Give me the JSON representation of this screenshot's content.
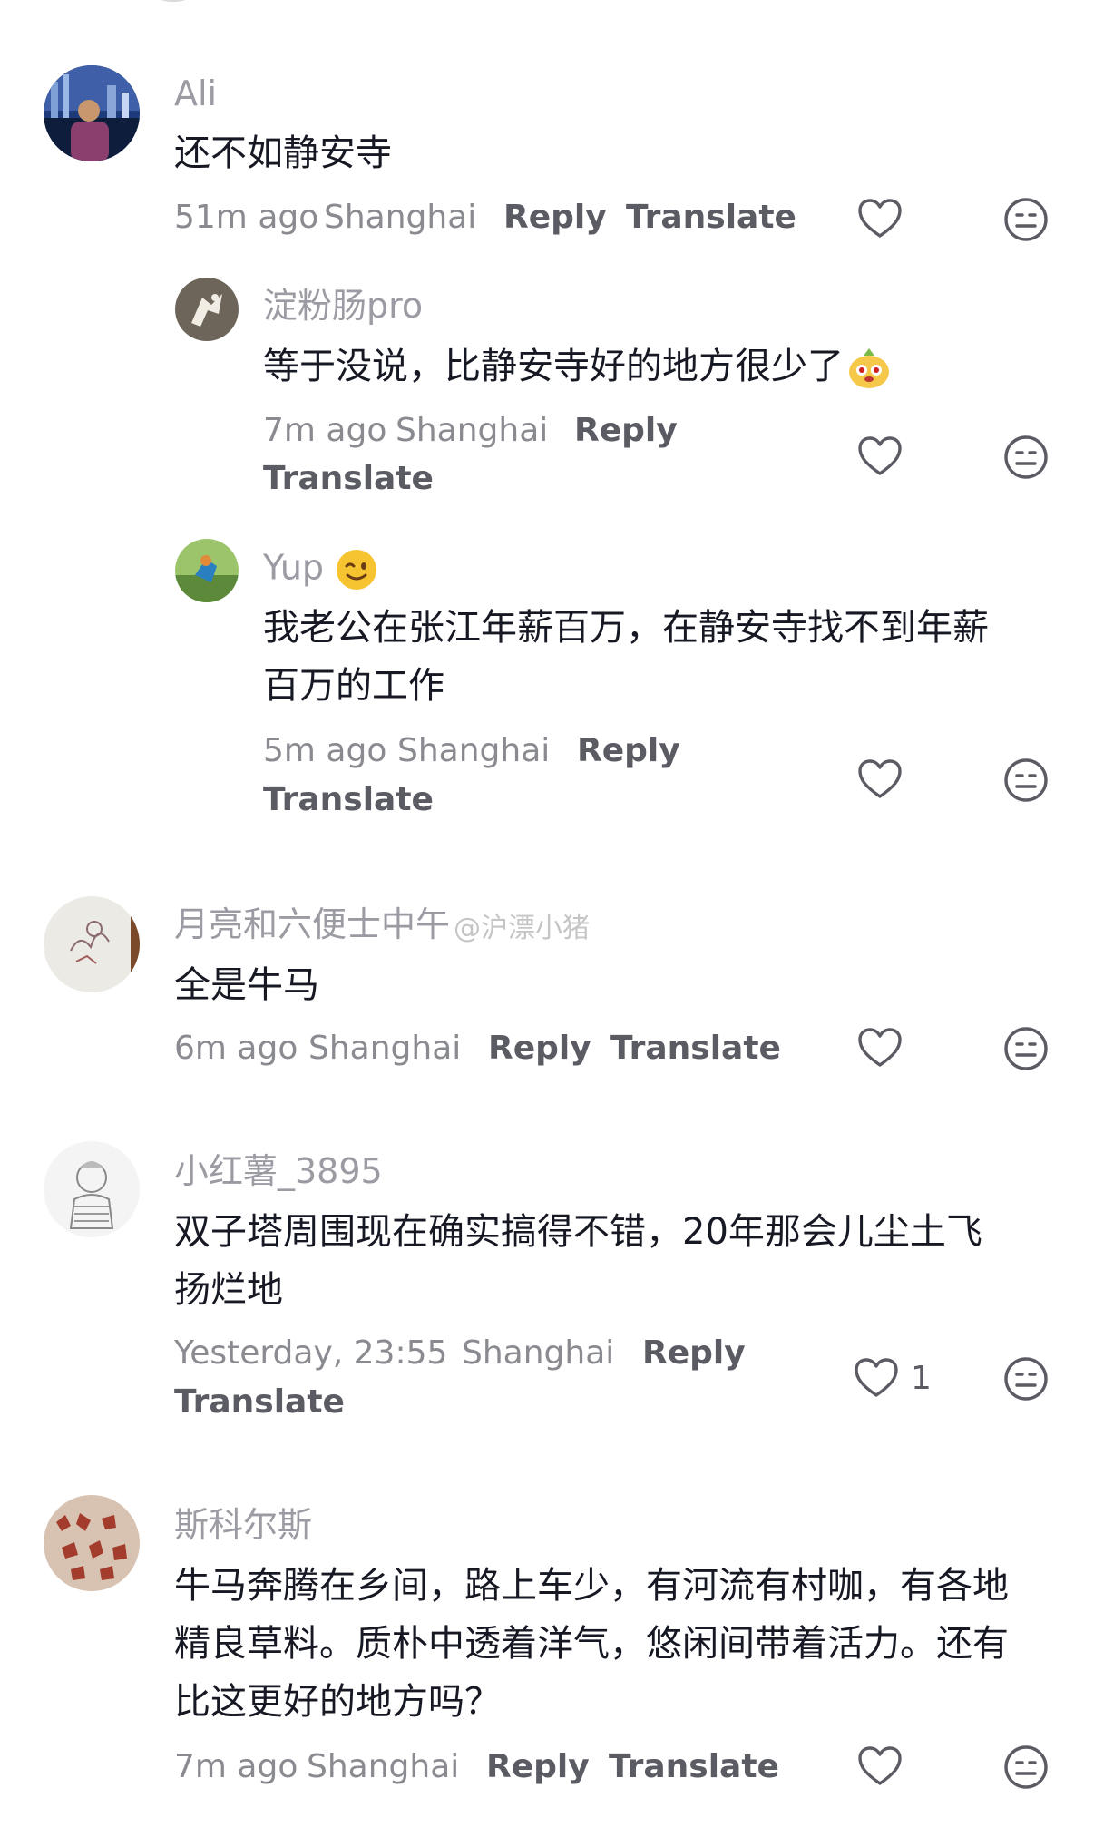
{
  "comments": [
    {
      "user": "Ali",
      "text": "还不如静安寺",
      "time": "51m ago",
      "location": "Shanghai",
      "reply_label": "Reply",
      "translate_label": "Translate"
    },
    {
      "user": "淀粉肠pro",
      "text": "等于没说，比静安寺好的地方很少了",
      "emoji": "cute-face-emoji",
      "time": "7m ago",
      "location": "Shanghai",
      "reply_label": "Reply",
      "translate_label": "Translate"
    },
    {
      "user": "Yup",
      "user_emoji": "winking-face-emoji",
      "text_line1": "我老公在张江年薪百万，在静安寺找不到年薪",
      "text_line2": "百万的工作",
      "time": "5m ago",
      "location": "Shanghai",
      "reply_label": "Reply",
      "translate_label": "Translate"
    },
    {
      "user": "月亮和六便士中午",
      "text": "全是牛马",
      "time": "6m ago",
      "location": "Shanghai",
      "reply_label": "Reply",
      "translate_label": "Translate"
    },
    {
      "user": "小红薯_3895",
      "text_line1": "双子塔周围现在确实搞得不错，20年那会儿尘土飞",
      "text_line2": "扬烂地",
      "time": "Yesterday, 23:55",
      "location": "Shanghai",
      "reply_label": "Reply",
      "translate_label": "Translate",
      "likes": "1"
    },
    {
      "user": "斯科尔斯",
      "text_line1": "牛马奔腾在乡间，路上车少，有河流有村咖，有各地",
      "text_line2": "精良草料。质朴中透着洋气，悠闲间带着活力。还有",
      "text_line3": "比这更好的地方吗？",
      "time": "7m ago",
      "location": "Shanghai",
      "reply_label": "Reply",
      "translate_label": "Translate"
    }
  ],
  "watermark": "@沪漂小猪",
  "colors": {
    "username": "#9b9ba3",
    "body": "#161823",
    "meta": "#8a8b91",
    "action": "#5a5b63"
  },
  "icons": [
    "heart-icon",
    "neutral-face-icon"
  ]
}
